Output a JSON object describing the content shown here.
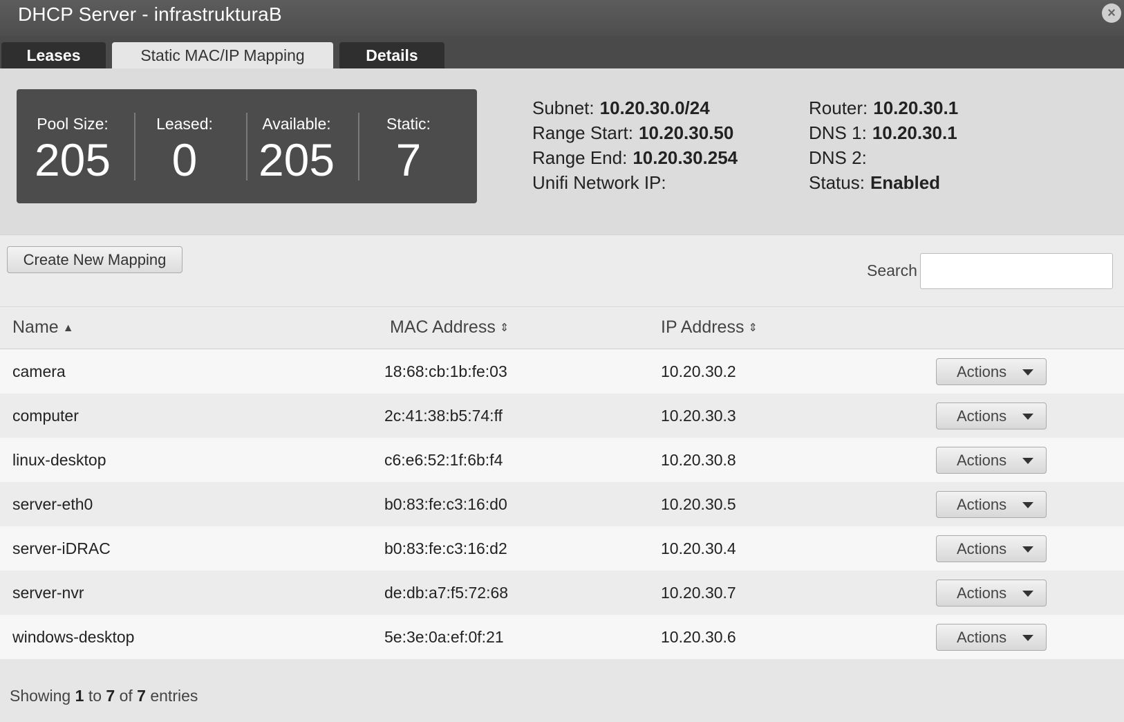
{
  "window": {
    "title": "DHCP Server - infrastrukturaB",
    "close_icon": "×"
  },
  "tabs": [
    {
      "label": "Leases",
      "active": false
    },
    {
      "label": "Static MAC/IP Mapping",
      "active": true
    },
    {
      "label": "Details",
      "active": false
    }
  ],
  "stats": [
    {
      "label": "Pool Size:",
      "value": "205"
    },
    {
      "label": "Leased:",
      "value": "0"
    },
    {
      "label": "Available:",
      "value": "205"
    },
    {
      "label": "Static:",
      "value": "7"
    }
  ],
  "info": {
    "subnet": {
      "label": "Subnet:",
      "value": "10.20.30.0/24"
    },
    "range_start": {
      "label": "Range Start:",
      "value": "10.20.30.50"
    },
    "range_end": {
      "label": "Range End:",
      "value": "10.20.30.254"
    },
    "unifi_ip": {
      "label": "Unifi Network IP:",
      "value": ""
    },
    "router": {
      "label": "Router:",
      "value": "10.20.30.1"
    },
    "dns1": {
      "label": "DNS 1:",
      "value": "10.20.30.1"
    },
    "dns2": {
      "label": "DNS 2:",
      "value": ""
    },
    "status": {
      "label": "Status:",
      "value": "Enabled"
    }
  },
  "toolbar": {
    "create_label": "Create New Mapping",
    "search_label": "Search",
    "search_value": ""
  },
  "table": {
    "columns": [
      {
        "label": "Name",
        "sort_icon": "sort-ascending-icon"
      },
      {
        "label": "MAC Address",
        "sort_icon": "sort-both-icon"
      },
      {
        "label": "IP Address",
        "sort_icon": "sort-both-icon"
      }
    ],
    "action_label": "Actions",
    "rows": [
      {
        "name": "camera",
        "mac": "18:68:cb:1b:fe:03",
        "ip": "10.20.30.2"
      },
      {
        "name": "computer",
        "mac": "2c:41:38:b5:74:ff",
        "ip": "10.20.30.3"
      },
      {
        "name": "linux-desktop",
        "mac": "c6:e6:52:1f:6b:f4",
        "ip": "10.20.30.8"
      },
      {
        "name": "server-eth0",
        "mac": "b0:83:fe:c3:16:d0",
        "ip": "10.20.30.5"
      },
      {
        "name": "server-iDRAC",
        "mac": "b0:83:fe:c3:16:d2",
        "ip": "10.20.30.4"
      },
      {
        "name": "server-nvr",
        "mac": "de:db:a7:f5:72:68",
        "ip": "10.20.30.7"
      },
      {
        "name": "windows-desktop",
        "mac": "5e:3e:0a:ef:0f:21",
        "ip": "10.20.30.6"
      }
    ]
  },
  "footer": {
    "prefix": "Showing",
    "from": "1",
    "to_word": "to",
    "to": "7",
    "of_word": "of",
    "total": "7",
    "suffix": "entries"
  }
}
